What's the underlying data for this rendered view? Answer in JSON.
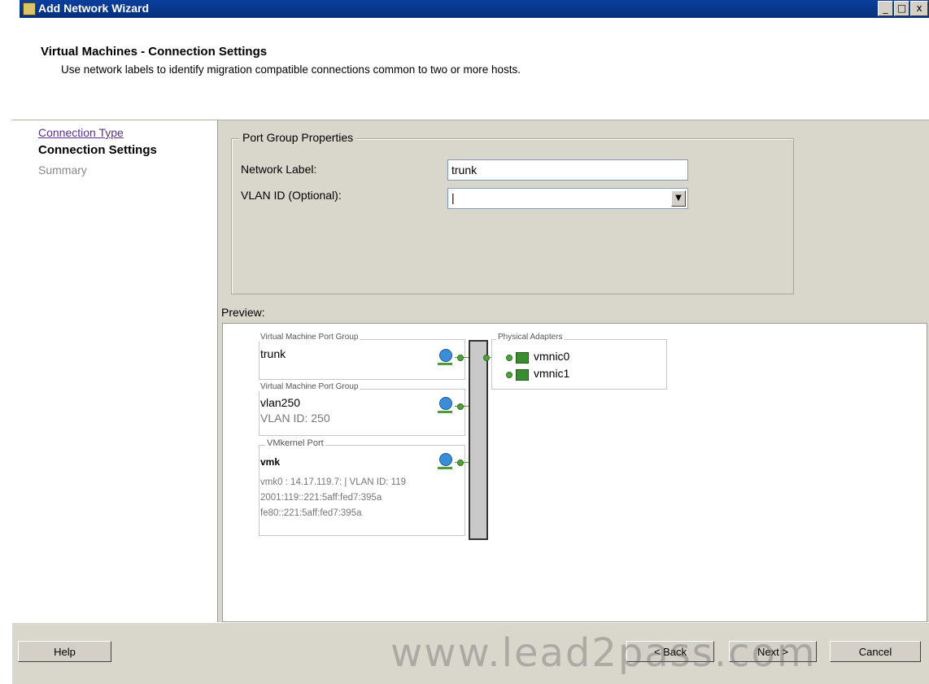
{
  "window": {
    "title": "Add Network Wizard",
    "controls": [
      "_",
      "□",
      "x"
    ]
  },
  "header": {
    "title": "Virtual Machines - Connection Settings",
    "subtitle": "Use network labels to identify migration compatible connections common to two or more hosts."
  },
  "nav": {
    "items": [
      {
        "label": "Connection Type",
        "state": "link"
      },
      {
        "label": "Connection Settings",
        "state": "current"
      },
      {
        "label": "Summary",
        "state": "disabled"
      }
    ]
  },
  "port_group_properties": {
    "legend": "Port Group Properties",
    "network_label_caption": "Network Label:",
    "network_label_value": "trunk",
    "vlan_caption": "VLAN ID (Optional):",
    "vlan_value": "|"
  },
  "preview": {
    "label": "Preview:",
    "port_groups": [
      {
        "caption": "Virtual Machine Port Group",
        "name": "trunk"
      },
      {
        "caption": "Virtual Machine Port Group",
        "name": "vlan250",
        "detail": "VLAN ID: 250"
      },
      {
        "caption": "VMkernel Port",
        "name": "vmk",
        "lines": [
          "vmk0 : 14.17.119.7: | VLAN ID: 119",
          "2001:119::221:5aff:fed7:395a",
          "fe80::221:5aff:fed7:395a"
        ]
      }
    ],
    "physical_adapters": {
      "caption": "Physical Adapters",
      "adapters": [
        "vmnic0",
        "vmnic1"
      ]
    }
  },
  "footer": {
    "help": "Help",
    "back": "< Back",
    "next": "Next >",
    "cancel": "Cancel",
    "watermark": "www.lead2pass.com"
  },
  "colors": {
    "titlebar": "#0a3f9d",
    "panel": "#d9d6cc",
    "link": "#5b2f8f",
    "connector": "#4ea33a"
  }
}
